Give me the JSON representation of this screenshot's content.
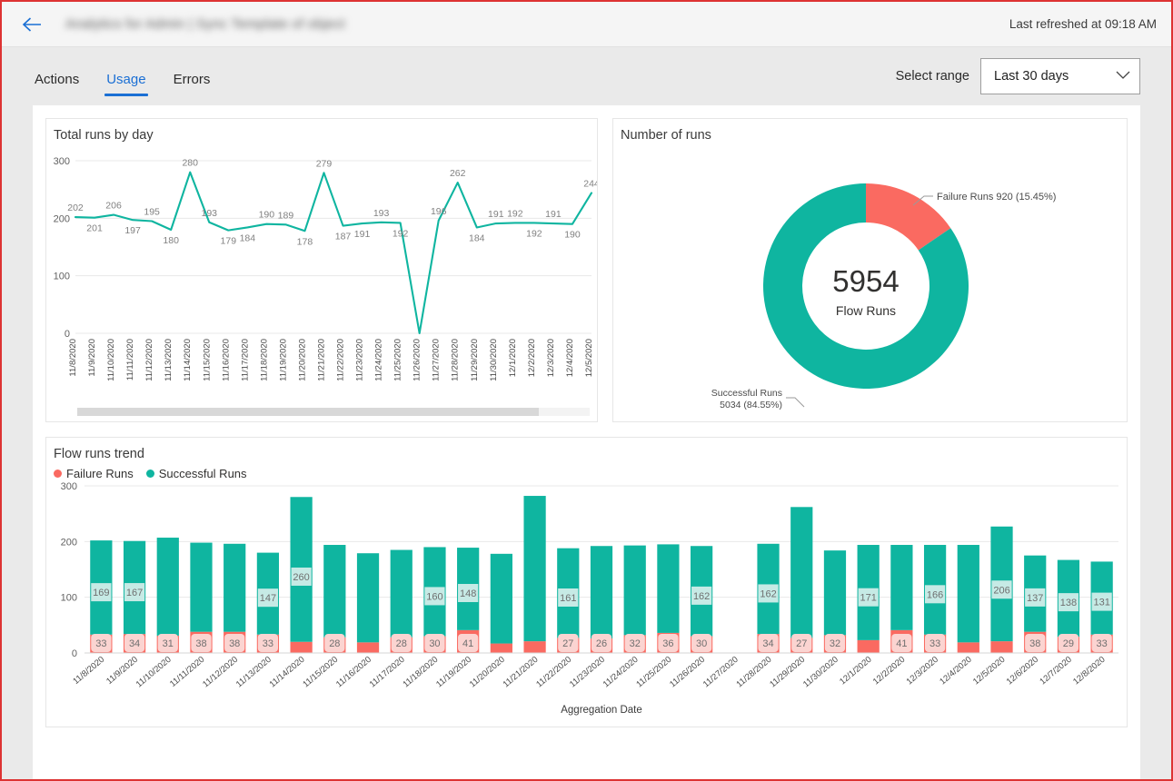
{
  "header": {
    "back_icon": "arrow-left-icon",
    "title": "Analytics for Admin | Sync Template of object",
    "refreshed": "Last refreshed at 09:18 AM"
  },
  "tabs": [
    {
      "label": "Actions",
      "active": false
    },
    {
      "label": "Usage",
      "active": true
    },
    {
      "label": "Errors",
      "active": false
    }
  ],
  "range": {
    "label": "Select range",
    "value": "Last 30 days",
    "chevron_icon": "chevron-down-icon"
  },
  "colors": {
    "teal": "#0FB5A0",
    "red": "#FA6A61",
    "red_fill": "#FBD4D1",
    "teal_fill": "#C6EAE5",
    "accent": "#1a6fd4",
    "axis": "#767676",
    "grid": "#e8e8e8"
  },
  "chart_data": [
    {
      "type": "line",
      "title": "Total runs by day",
      "xlabel": "",
      "ylabel": "",
      "ylim": [
        0,
        300
      ],
      "yticks": [
        0,
        100,
        200,
        300
      ],
      "grid": true,
      "legend": "none",
      "categories": [
        "11/8/2020",
        "11/9/2020",
        "11/10/2020",
        "11/11/2020",
        "11/12/2020",
        "11/13/2020",
        "11/14/2020",
        "11/15/2020",
        "11/16/2020",
        "11/17/2020",
        "11/18/2020",
        "11/19/2020",
        "11/20/2020",
        "11/21/2020",
        "11/22/2020",
        "11/23/2020",
        "11/24/2020",
        "11/25/2020",
        "11/26/2020",
        "11/27/2020",
        "11/28/2020",
        "11/29/2020",
        "11/30/2020",
        "12/1/2020",
        "12/2/2020",
        "12/3/2020",
        "12/4/2020",
        "12/5/2020"
      ],
      "values": [
        202,
        201,
        206,
        197,
        195,
        180,
        280,
        193,
        179,
        184,
        190,
        189,
        178,
        279,
        187,
        191,
        193,
        192,
        0,
        196,
        262,
        184,
        191,
        192,
        192,
        191,
        190,
        244
      ],
      "labels_above": [
        202,
        null,
        206,
        null,
        195,
        null,
        280,
        193,
        null,
        null,
        190,
        189,
        null,
        279,
        null,
        null,
        193,
        null,
        null,
        196,
        262,
        null,
        191,
        192,
        null,
        191,
        null,
        244
      ],
      "labels_below": [
        null,
        201,
        null,
        197,
        null,
        180,
        null,
        null,
        179,
        184,
        null,
        null,
        178,
        null,
        187,
        191,
        null,
        192,
        null,
        null,
        null,
        184,
        null,
        null,
        192,
        null,
        190,
        null
      ]
    },
    {
      "type": "pie",
      "title": "Number of runs",
      "center_value": "5954",
      "center_label": "Flow Runs",
      "slices": [
        {
          "name": "Failure Runs",
          "value": 920,
          "percent": "15.45%",
          "label": "Failure Runs 920 (15.45%)",
          "color": "#FA6A61"
        },
        {
          "name": "Successful Runs",
          "value": 5034,
          "percent": "84.55%",
          "label_line1": "Successful Runs",
          "label_line2": "5034 (84.55%)",
          "color": "#0FB5A0"
        }
      ]
    },
    {
      "type": "bar",
      "title": "Flow runs trend",
      "stacked": true,
      "xlabel": "Aggregation Date",
      "ylabel": "",
      "ylim": [
        0,
        300
      ],
      "yticks": [
        0,
        100,
        200,
        300
      ],
      "grid": true,
      "legend": [
        "Failure Runs",
        "Successful Runs"
      ],
      "legend_position": "top-left",
      "categories": [
        "11/8/2020",
        "11/9/2020",
        "11/10/2020",
        "11/11/2020",
        "11/12/2020",
        "11/13/2020",
        "11/14/2020",
        "11/15/2020",
        "11/16/2020",
        "11/17/2020",
        "11/18/2020",
        "11/19/2020",
        "11/20/2020",
        "11/21/2020",
        "11/22/2020",
        "11/23/2020",
        "11/24/2020",
        "11/25/2020",
        "11/26/2020",
        "11/27/2020",
        "11/28/2020",
        "11/29/2020",
        "11/30/2020",
        "12/1/2020",
        "12/2/2020",
        "12/3/2020",
        "12/4/2020",
        "12/5/2020",
        "12/6/2020",
        "12/7/2020",
        "12/8/2020"
      ],
      "series": [
        {
          "name": "Failure Runs",
          "color": "#FA6A61",
          "values": [
            33,
            34,
            31,
            38,
            38,
            33,
            20,
            28,
            19,
            28,
            30,
            41,
            17,
            21,
            27,
            26,
            32,
            36,
            30,
            null,
            34,
            27,
            32,
            23,
            41,
            33,
            19,
            21,
            38,
            29,
            33
          ],
          "labels": [
            33,
            34,
            31,
            38,
            38,
            33,
            null,
            28,
            null,
            28,
            30,
            41,
            null,
            null,
            27,
            26,
            32,
            36,
            30,
            null,
            34,
            27,
            32,
            null,
            41,
            33,
            null,
            null,
            38,
            29,
            33
          ]
        },
        {
          "name": "Successful Runs",
          "color": "#0FB5A0",
          "values": [
            169,
            167,
            176,
            160,
            158,
            147,
            260,
            166,
            160,
            157,
            160,
            148,
            161,
            261,
            161,
            166,
            161,
            159,
            162,
            null,
            162,
            235,
            152,
            171,
            153,
            161,
            175,
            206,
            137,
            138,
            131
          ],
          "labels": [
            169,
            167,
            null,
            null,
            null,
            147,
            260,
            null,
            null,
            null,
            160,
            148,
            null,
            null,
            161,
            null,
            null,
            null,
            162,
            null,
            162,
            null,
            null,
            171,
            null,
            166,
            null,
            206,
            137,
            138,
            131
          ]
        }
      ]
    }
  ]
}
